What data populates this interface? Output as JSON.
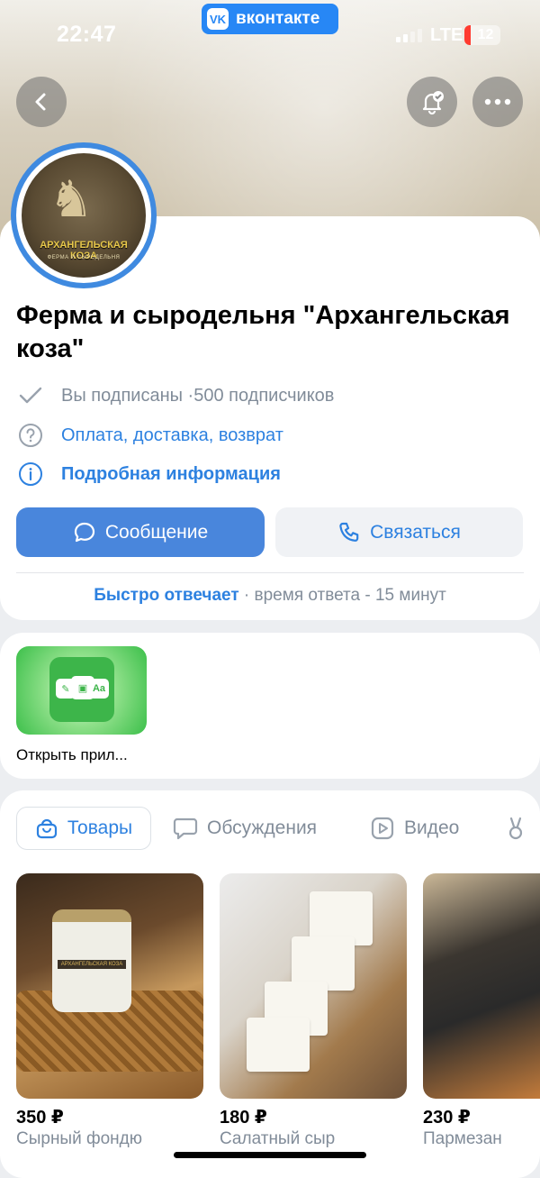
{
  "status_bar": {
    "time": "22:47",
    "app_pill": "вконтакте",
    "network": "LTE",
    "battery": "12"
  },
  "header": {
    "back_icon": "chevron-left-icon",
    "notify_icon": "bell-check-icon",
    "more_icon": "more-dots-icon"
  },
  "profile": {
    "avatar_brand": "АРХАНГЕЛЬСКАЯ КОЗА",
    "avatar_sub": "ФЕРМА И СЫРОДЕЛЬНЯ",
    "title": "Ферма и сыродельня \"Архангельская коза\"",
    "subscribed": "Вы подписаны · ",
    "subscribers": "500 подписчиков",
    "payment_link": "Оплата, доставка, возврат",
    "details_link": "Подробная информация",
    "message_button": "Сообщение",
    "contact_button": "Связаться",
    "fast_reply": "Быстро отвечает",
    "reply_time": " · время ответа - 15 минут"
  },
  "apps": {
    "open_app_label": "Открыть прил..."
  },
  "tabs": [
    {
      "label": "Товары",
      "icon": "bag-icon"
    },
    {
      "label": "Обсуждения",
      "icon": "chat-icon"
    },
    {
      "label": "Видео",
      "icon": "video-icon"
    },
    {
      "label": "",
      "icon": "clips-icon"
    }
  ],
  "products": [
    {
      "price": "350 ₽",
      "name": "Сырный фондю"
    },
    {
      "price": "180 ₽",
      "name": "Салатный сыр"
    },
    {
      "price": "230 ₽",
      "name": "Пармезан"
    }
  ],
  "colors": {
    "accent": "#2d81e0",
    "button_primary": "#4986dc",
    "secondary_text": "#818c99"
  }
}
